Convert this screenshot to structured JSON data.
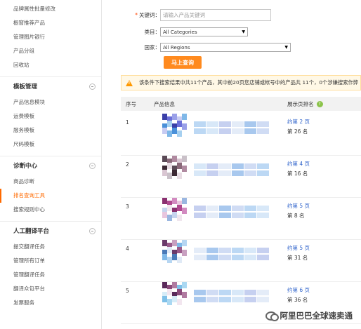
{
  "sidebar": {
    "top_items": [
      "品牌属性批量修改",
      "橱窗推荐产品",
      "管理图片银行",
      "产品分组",
      "回收站"
    ],
    "groups": [
      {
        "title": "模板管理",
        "items": [
          "产品信息模块",
          "运费模板",
          "服务模板",
          "尺码模板"
        ]
      },
      {
        "title": "诊断中心",
        "items": [
          "商品诊断",
          "排名查询工具",
          "搜索规则中心"
        ]
      },
      {
        "title": "人工翻译平台",
        "items": [
          "提交翻译任务",
          "管理所有订单",
          "管理翻译任务",
          "翻译众包平台",
          "发票服务"
        ]
      }
    ],
    "active_item": "排名查询工具"
  },
  "form": {
    "keyword_label": "关键词：",
    "keyword_placeholder": "请输入产品关键词",
    "category_label": "类目：",
    "category_value": "All Categories",
    "region_label": "国家：",
    "region_value": "All Regions",
    "query_button": "马上查询"
  },
  "notice": "该条件下搜索结果中共11个产品，其中前20页您店铺或帐号中的产品共 11个，0个涉嫌搜索作弊",
  "table": {
    "headers": {
      "no": "序号",
      "info": "产品信息",
      "rank": "展示页排名"
    },
    "rows": [
      {
        "no": "1",
        "page": "约第 2 页",
        "pos": "第 26 名"
      },
      {
        "no": "2",
        "page": "约第 4 页",
        "pos": "第 16 名"
      },
      {
        "no": "3",
        "page": "约第 5 页",
        "pos": "第 8 名"
      },
      {
        "no": "4",
        "page": "约第 5 页",
        "pos": "第 31 名"
      },
      {
        "no": "5",
        "page": "约第 6 页",
        "pos": "第 36 名"
      }
    ]
  },
  "watermark": "阿里巴巴全球速卖通",
  "colors": {
    "accent": "#ff6a00",
    "button": "#ff8a1e",
    "link": "#3366cc",
    "help": "#8bc34a"
  }
}
